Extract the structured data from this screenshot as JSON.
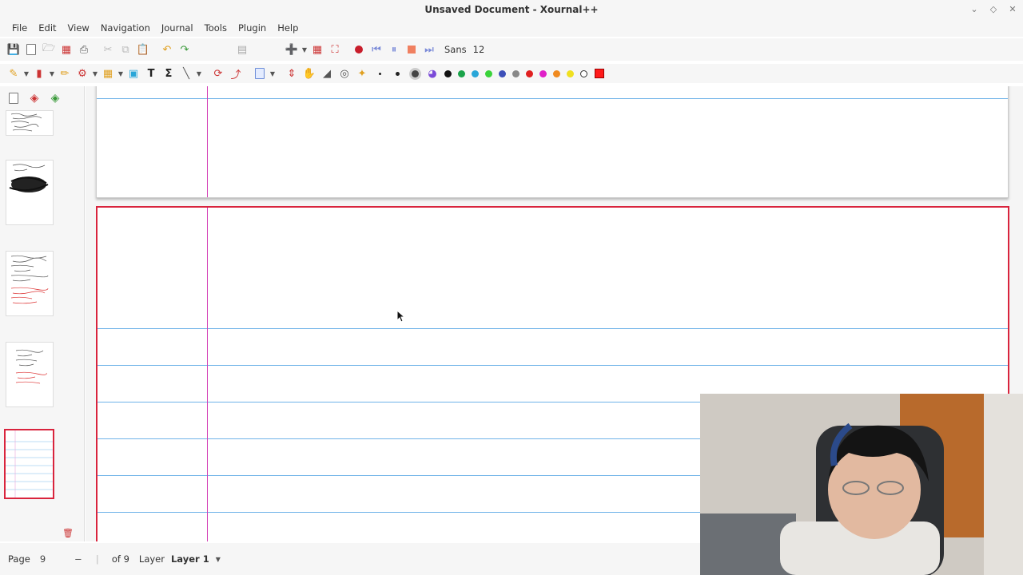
{
  "window": {
    "title": "Unsaved Document - Xournal++",
    "controls": [
      "minimize-icon",
      "restore-icon",
      "close-icon"
    ]
  },
  "menu": [
    "File",
    "Edit",
    "View",
    "Navigation",
    "Journal",
    "Tools",
    "Plugin",
    "Help"
  ],
  "toolbar": {
    "font_name": "Sans",
    "font_size": "12",
    "colors": [
      "#111111",
      "#1aa34a",
      "#29a6d8",
      "#3ad33a",
      "#3d4fb8",
      "#888888",
      "#e02020",
      "#e020c8",
      "#f08a20",
      "#f0e020",
      "#ffffff"
    ],
    "active_color": "#ff1a1a"
  },
  "statusbar": {
    "page_label": "Page",
    "page_value": "9",
    "page_of": "of 9",
    "layer_label": "Layer",
    "layer_value": "Layer 1"
  }
}
